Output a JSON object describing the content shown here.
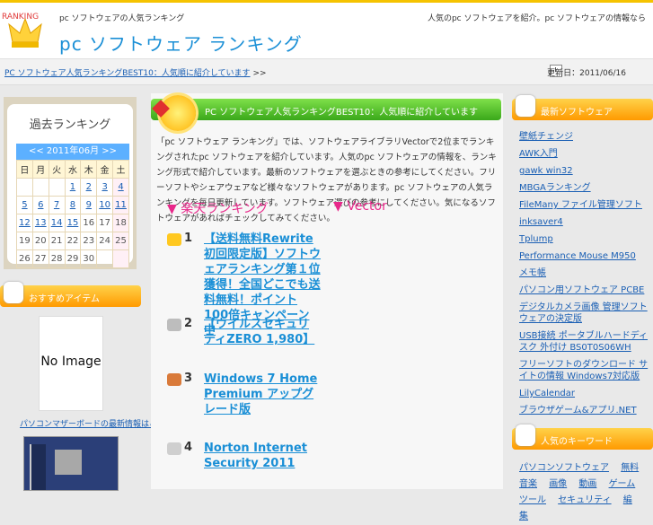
{
  "header": {
    "logo_text": "RANKING",
    "site_tag": "pc ソフトウェアの人気ランキング",
    "site_title": "pc ソフトウェア ランキング",
    "right_text": "人気のpc ソフトウェアを紹介。pc ソフトウェアの情報なら"
  },
  "breadcrumb": {
    "link": "PC ソフトウェア人気ランキングBEST10：人気順に紹介しています",
    "sep": ">>"
  },
  "date": {
    "label": "更新日：2011/06/16"
  },
  "calendar": {
    "title": "過去ランキング",
    "nav": "<<  2011年06月  >>",
    "weekdays": [
      "日",
      "月",
      "火",
      "水",
      "木",
      "金",
      "土"
    ],
    "rows": [
      [
        "",
        "",
        "",
        "1",
        "2",
        "3",
        "4"
      ],
      [
        "5",
        "6",
        "7",
        "8",
        "9",
        "10",
        "11"
      ],
      [
        "12",
        "13",
        "14",
        "15",
        "16",
        "17",
        "18"
      ],
      [
        "19",
        "20",
        "21",
        "22",
        "23",
        "24",
        "25"
      ],
      [
        "26",
        "27",
        "28",
        "29",
        "30",
        "",
        ""
      ]
    ]
  },
  "left": {
    "section_title": "おすすめアイテム",
    "noimage": "No Image",
    "product_link": "パソコンマザーボードの最新情報はこちらafb"
  },
  "main": {
    "title": "PC ソフトウェア人気ランキングBEST10：人気順に紹介しています",
    "intro": "「pc ソフトウェア ランキング」では、ソフトウェアライブラリVectorで2位までランキングされたpc ソフトウェアを紹介しています。人気のpc ソフトウェアの情報を、ランキング形式で紹介しています。最新のソフトウェアを選ぶときの参考にしてください。フリーソフトやシェアウェアなど様々なソフトウェアがあります。pc ソフトウェアの人気ランキングを毎日更新しています。ソフトウェア選びの参考にしてください。気になるソフトウェアがあればチェックしてみてください。",
    "col1_heading": "▼ 楽天ランキング",
    "col2_heading": "▼ Vector",
    "ranks": [
      {
        "num": "1",
        "text": "【送料無料Rewrite 初回限定版】ソフトウェアランキング第１位獲得！全国どこでも送料無料！ポイント100倍キャンペーン中"
      },
      {
        "num": "2",
        "text": "【ウイルスセキュリティZERO 1,980】"
      },
      {
        "num": "3",
        "text": "Windows 7 Home Premium アップグレード版"
      },
      {
        "num": "4",
        "text": "Norton Internet Security 2011"
      }
    ]
  },
  "right": {
    "section1_title": "最新ソフトウェア",
    "links": [
      "壁紙チェンジ",
      "AWK入門",
      "gawk win32",
      "MBGAランキング",
      "FileMany ファイル管理ソフト",
      "inksaver4",
      "Tplump",
      "Performance Mouse M950",
      "メモ帳",
      "パソコン用ソフトウェア PCBE",
      "デジタルカメラ画像 管理ソフトウェアの決定版",
      "USB接続 ポータブルハードディスク 外付け BS0T0S06WH",
      "フリーソフトのダウンロード サイトの情報 Windows7対応版",
      "LilyCalendar",
      "ブラウザゲーム&アプリ.NET"
    ],
    "section2_title": "人気のキーワード",
    "tags": [
      "パソコンソフトウェア",
      "無料",
      "音楽",
      "画像",
      "動画",
      "ゲーム",
      "ツール",
      "セキュリティ",
      "編集"
    ]
  },
  "colors": {
    "accent_orange": "#ff9a00",
    "accent_green": "#3aa81a",
    "link_blue": "#1a5fb4",
    "title_blue": "#1a8fd6",
    "heading_pink": "#e8288a"
  }
}
